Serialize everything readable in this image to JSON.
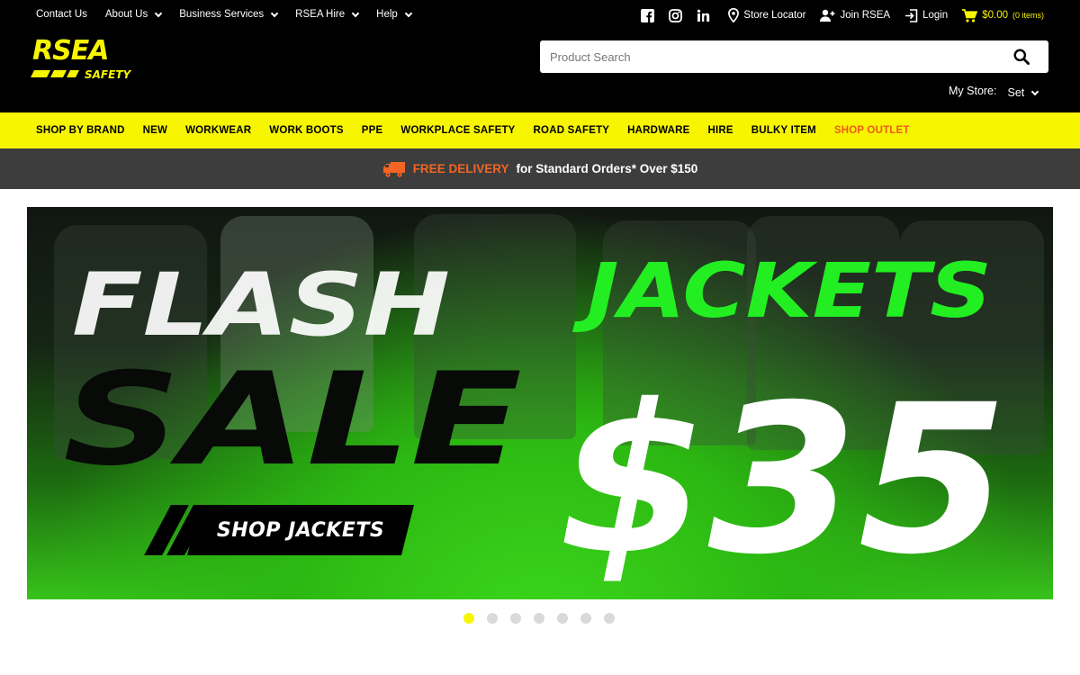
{
  "utility_nav": {
    "left_items": [
      {
        "label": "Contact Us",
        "has_dropdown": false
      },
      {
        "label": "About Us",
        "has_dropdown": true
      },
      {
        "label": "Business Services",
        "has_dropdown": true
      },
      {
        "label": "RSEA Hire",
        "has_dropdown": true
      },
      {
        "label": "Help",
        "has_dropdown": true
      }
    ],
    "social_icons": [
      "facebook-icon",
      "instagram-icon",
      "linkedin-icon"
    ],
    "store_locator_label": "Store Locator",
    "join_label": "Join RSEA",
    "login_label": "Login",
    "cart_total": "$0.00",
    "cart_items": "(0 items)"
  },
  "logo": {
    "line1": "RSEA",
    "line2": "SAFETY"
  },
  "search": {
    "placeholder": "Product Search"
  },
  "store": {
    "label": "My Store:",
    "value": "Set"
  },
  "main_nav": [
    "SHOP BY BRAND",
    "NEW",
    "WORKWEAR",
    "WORK BOOTS",
    "PPE",
    "WORKPLACE SAFETY",
    "ROAD SAFETY",
    "HARDWARE",
    "HIRE",
    "BULKY ITEM",
    "SHOP OUTLET"
  ],
  "promo": {
    "highlight": "FREE DELIVERY",
    "text": "for Standard Orders* Over $150"
  },
  "hero": {
    "line1": "FLASH",
    "line2": "SALE",
    "headline": "JACKETS",
    "price": "$35",
    "cta_label": "SHOP JACKETS"
  },
  "carousel": {
    "slide_count": 7,
    "active_index": 0
  },
  "colors": {
    "brand_yellow": "#f7f500",
    "accent_orange": "#f26522",
    "hero_green": "#22ee22",
    "header_black": "#000000",
    "promo_grey": "#3d3d3d"
  }
}
